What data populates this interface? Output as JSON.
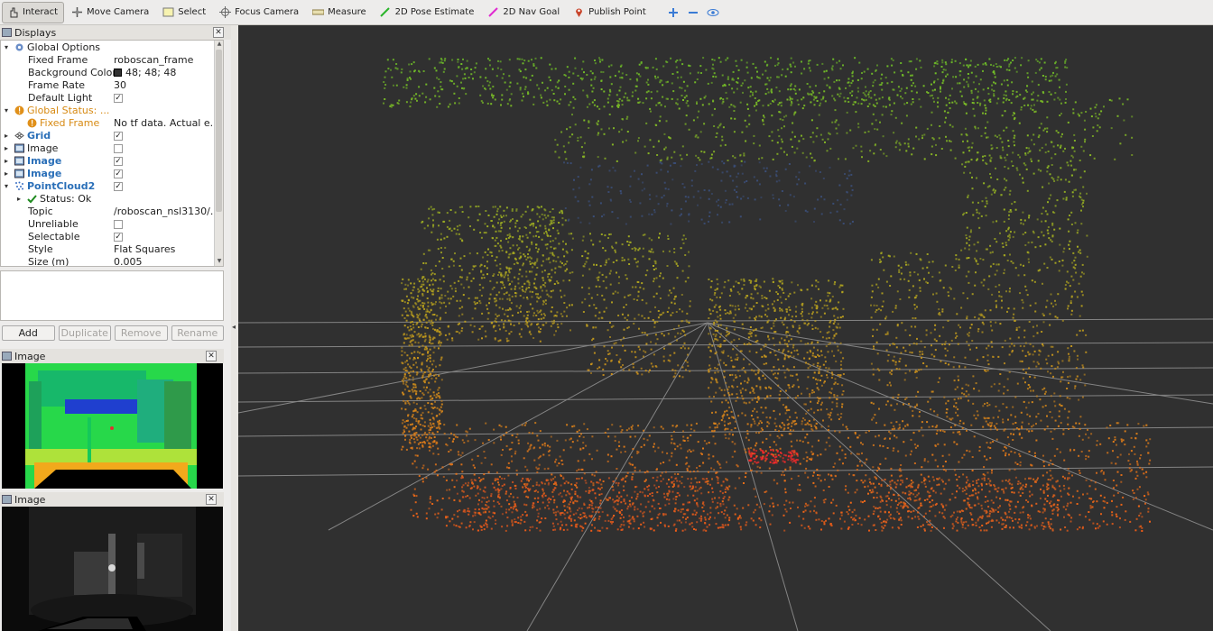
{
  "toolbar": {
    "tools": [
      {
        "name": "interact-button",
        "icon": "hand-cursor-icon",
        "label": "Interact",
        "active": true
      },
      {
        "name": "move-camera-button",
        "icon": "move-arrows-icon",
        "label": "Move Camera",
        "active": false
      },
      {
        "name": "select-button",
        "icon": "select-box-icon",
        "label": "Select",
        "active": false
      },
      {
        "name": "focus-camera-button",
        "icon": "crosshair-icon",
        "label": "Focus Camera",
        "active": false
      },
      {
        "name": "measure-button",
        "icon": "ruler-icon",
        "label": "Measure",
        "active": false
      },
      {
        "name": "pose-estimate-button",
        "icon": "green-arrow-icon",
        "label": "2D Pose Estimate",
        "active": false
      },
      {
        "name": "nav-goal-button",
        "icon": "magenta-arrow-icon",
        "label": "2D Nav Goal",
        "active": false
      },
      {
        "name": "publish-point-button",
        "icon": "map-pin-icon",
        "label": "Publish Point",
        "active": false
      }
    ]
  },
  "displays": {
    "title": "Displays",
    "rows": [
      {
        "label": "Global Options",
        "arrow": "▾",
        "icon": "gear",
        "indent": 0
      },
      {
        "label": "Fixed Frame",
        "value": "roboscan_frame",
        "indent": 1
      },
      {
        "label": "Background Color",
        "value": "48; 48; 48",
        "swatch": "#303030",
        "indent": 1
      },
      {
        "label": "Frame Rate",
        "value": "30",
        "indent": 1
      },
      {
        "label": "Default Light",
        "check": true,
        "indent": 1
      },
      {
        "label": "Global Status: ...",
        "arrow": "▾",
        "icon": "warn",
        "style": "orange",
        "indent": 0
      },
      {
        "label": "Fixed Frame",
        "value": "No tf data.  Actual e...",
        "icon": "warn",
        "style": "orange",
        "indent": 1
      },
      {
        "label": "Grid",
        "arrow": "▸",
        "icon": "grid",
        "style": "blue",
        "check": true,
        "indent": 0
      },
      {
        "label": "Image",
        "arrow": "▸",
        "icon": "image",
        "check": false,
        "indent": 0
      },
      {
        "label": "Image",
        "arrow": "▸",
        "icon": "image",
        "style": "blue",
        "check": true,
        "indent": 0
      },
      {
        "label": "Image",
        "arrow": "▸",
        "icon": "image",
        "style": "blue",
        "check": true,
        "indent": 0
      },
      {
        "label": "PointCloud2",
        "arrow": "▾",
        "icon": "cloud",
        "style": "blue",
        "check": true,
        "indent": 0
      },
      {
        "label": "Status: Ok",
        "arrow": "▸",
        "icon": "ok",
        "indent": 1
      },
      {
        "label": "Topic",
        "value": "/roboscan_nsl3130/...",
        "indent": 1
      },
      {
        "label": "Unreliable",
        "check": false,
        "indent": 1
      },
      {
        "label": "Selectable",
        "check": true,
        "indent": 1
      },
      {
        "label": "Style",
        "value": "Flat Squares",
        "indent": 1
      },
      {
        "label": "Size (m)",
        "value": "0.005",
        "indent": 1
      }
    ]
  },
  "buttons": {
    "add": "Add",
    "duplicate": "Duplicate",
    "remove": "Remove",
    "rename": "Rename"
  },
  "image_panels": {
    "first_title": "Image",
    "second_title": "Image"
  },
  "colors": {
    "background": "#303030",
    "grid": "#a0a0a0",
    "accent_blue": "#2a6fb8",
    "warn_orange": "#d78a13"
  }
}
